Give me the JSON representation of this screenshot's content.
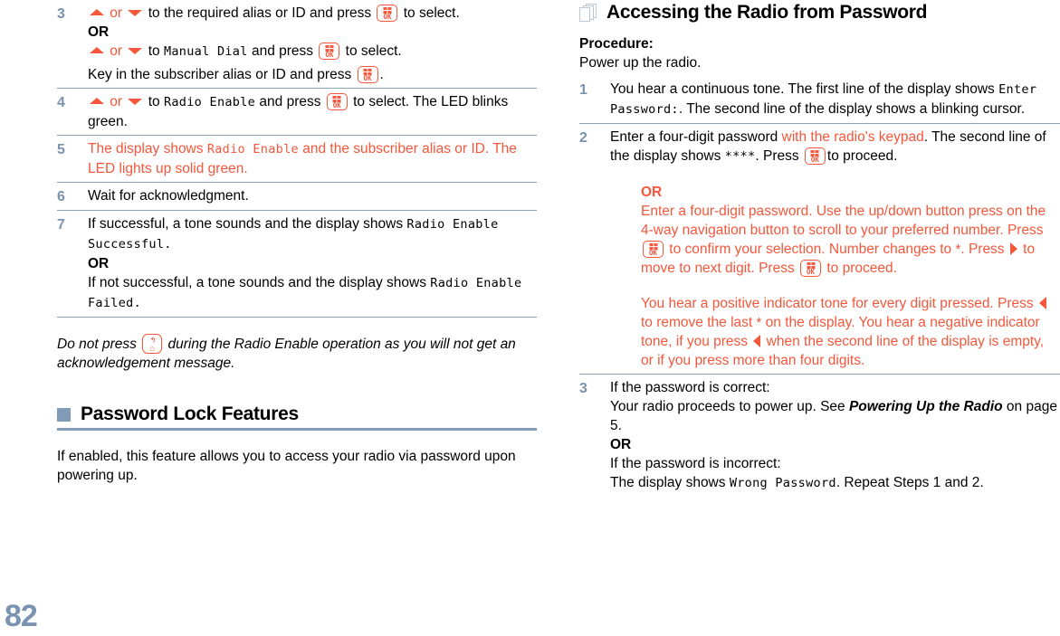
{
  "page_number": "82",
  "colors": {
    "accent_orange": "#f4573b",
    "heading_blue": "#7f9bb5",
    "step_number_blue": "#7a93b0"
  },
  "left_column": {
    "steps": [
      {
        "number": "3",
        "lines": [
          {
            "pre": "",
            "nav_up": true,
            "or": " or ",
            "nav_down": true,
            "mid": " to the required alias or ID and press ",
            "key": "ok",
            "post": " to select."
          },
          {
            "or_label": "OR"
          },
          {
            "nav_up": true,
            "or": " or ",
            "nav_down": true,
            "mid_plain": " to ",
            "mono": "Manual Dial",
            "mid2": " and press ",
            "key": "ok",
            "post": " to select."
          },
          {
            "plain": "Key in the subscriber alias or ID and press ",
            "key": "ok",
            "post": "."
          }
        ]
      },
      {
        "number": "4",
        "text_a": " to ",
        "mono": "Radio Enable",
        "text_b": " and press ",
        "text_c": " to select. The LED blinks green."
      },
      {
        "number": "5",
        "text_a": " The display shows ",
        "mono": "Radio Enable",
        "text_b": " and the subscriber alias or ID. The LED lights up solid green."
      },
      {
        "number": "6",
        "text": "Wait for acknowledgment."
      },
      {
        "number": "7",
        "text_a": "If successful, a tone sounds and the display shows ",
        "mono_a": "Radio Enable Successful",
        "text_b": ".",
        "or_label": "OR",
        "text_c": "If not successful, a tone sounds and the display shows ",
        "mono_b": "Radio Enable Failed",
        "text_d": "."
      }
    ],
    "note": {
      "text_a": "Do not press ",
      "text_b": " during the Radio Enable operation as you will not get an acknowledgement message."
    },
    "section": {
      "title": "Password Lock Features",
      "body": "If enabled, this feature allows you to access your radio via password upon powering up."
    }
  },
  "right_column": {
    "section": {
      "title": "Accessing the Radio from Password",
      "procedure_label": "Procedure:",
      "procedure_intro": "Power up the radio."
    },
    "steps": [
      {
        "number": "1",
        "text_a": "You hear a continuous tone. The first line of the display shows ",
        "mono": "Enter Password:",
        "text_b": ". The second line of the display shows a blinking cursor."
      },
      {
        "number": "2",
        "text_a": "Enter a four-digit password ",
        "orange_a": "with the radio's keypad",
        "text_b": ". The second line of the display shows ",
        "mono_stars": "****",
        "text_c": ". Press ",
        "text_d": "to proceed.",
        "or_label": "OR",
        "or_block_a": "Enter a four-digit password. Use the up/down button press on the 4-way navigation button to scroll to your preferred number. Press ",
        "or_block_b": " to confirm your selection. Number changes to ",
        "or_block_star": "*",
        "or_block_c": ". Press ",
        "or_block_d": " to move to next digit. Press ",
        "or_block_e": " to proceed.",
        "tone_block_a": "You hear a positive indicator tone for every digit pressed. Press ",
        "tone_block_b": " to remove the last ",
        "tone_block_star": "*",
        "tone_block_c": " on the display. You hear a negative indicator tone, if you press ",
        "tone_block_d": " when the second line of the display is empty, or if you press more than four digits."
      },
      {
        "number": "3",
        "line1": "If the password is correct:",
        "line2_a": "Your radio proceeds to power up. See ",
        "line2_bold": "Powering Up the Radio",
        "line2_b": " on page 5.",
        "or_label": "OR",
        "line3": "If the password is incorrect:",
        "line4_a": "The display shows ",
        "line4_mono": "Wrong Password",
        "line4_b": ". Repeat Steps 1 and 2."
      }
    ]
  },
  "icons": {
    "ok_key_label": "OK",
    "back_key_arc": "↰",
    "back_key_home": "⌂",
    "nav_up": "nav-up-triangle",
    "nav_down": "nav-down-triangle",
    "nav_right": "nav-right-triangle",
    "nav_left": "nav-left-triangle"
  }
}
